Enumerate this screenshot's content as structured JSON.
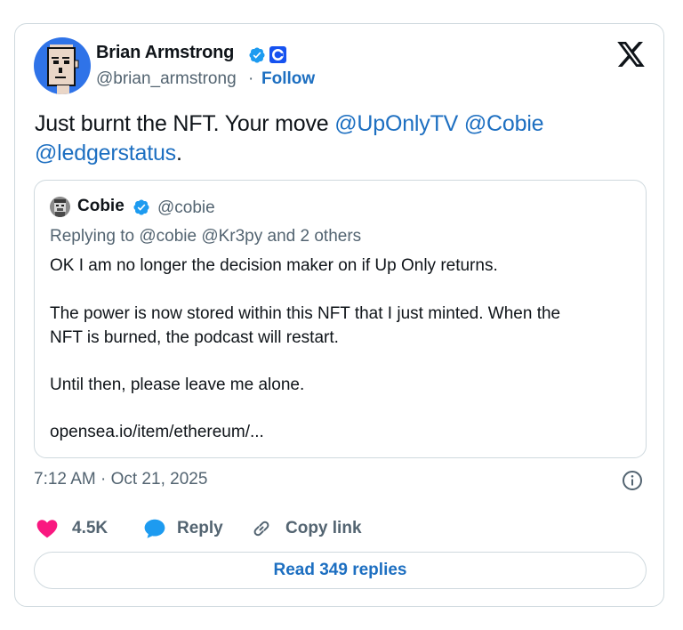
{
  "author": {
    "name": "Brian Armstrong",
    "handle": "@brian_armstrong",
    "separator": "·",
    "follow_label": "Follow"
  },
  "tweet": {
    "text_prefix": "Just burnt the NFT. Your move ",
    "mentions": [
      "@UpOnlyTV",
      "@Cobie",
      "@ledgerstatus"
    ],
    "text_suffix": "."
  },
  "quoted": {
    "name": "Cobie",
    "handle": "@cobie",
    "replying_to": "Replying to @cobie @Kr3py and 2 others",
    "lines": [
      "OK I am no longer the decision maker on if Up Only returns.",
      "The power is now stored within this NFT that I just minted. When the",
      "NFT is burned, the podcast will restart.",
      "Until then, please leave me alone.",
      "opensea.io/item/ethereum/..."
    ]
  },
  "meta": {
    "timestamp": "7:12 AM · Oct 21, 2025"
  },
  "actions": {
    "likes": "4.5K",
    "reply_label": "Reply",
    "copy_link_label": "Copy link"
  },
  "footer": {
    "read_replies_label": "Read 349 replies"
  },
  "colors": {
    "link": "#1d6fc1",
    "verified": "#1d9bf0",
    "like": "#f91880",
    "coinbase": "#1652f0",
    "secondary_text": "#536471",
    "border": "#cfd9de"
  },
  "icons": {
    "verified": "verified-badge-icon",
    "org_badge": "coinbase-logo-icon",
    "brand": "x-logo-icon",
    "info": "info-icon",
    "like": "heart-icon",
    "reply": "speech-bubble-icon",
    "copy_link": "link-icon"
  }
}
